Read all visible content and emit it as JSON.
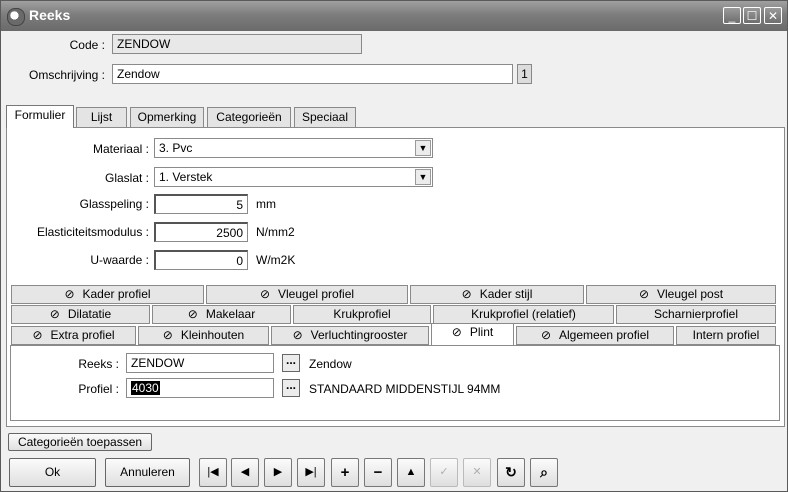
{
  "window": {
    "title": "Reeks",
    "buttons": {
      "minimize": "_",
      "maximize": "☐",
      "close": "✕"
    }
  },
  "header": {
    "code_label": "Code :",
    "code_value": "ZENDOW",
    "omschrijving_label": "Omschrijving :",
    "omschrijving_value": "Zendow",
    "counter": "1"
  },
  "tabs": [
    {
      "label": "Formulier"
    },
    {
      "label": "Lijst"
    },
    {
      "label": "Opmerking"
    },
    {
      "label": "Categorieën"
    },
    {
      "label": "Speciaal"
    }
  ],
  "form": {
    "materiaal_label": "Materiaal :",
    "materiaal_value": "3.  Pvc",
    "glaslat_label": "Glaslat :",
    "glaslat_value": "1.  Verstek",
    "glasspeling_label": "Glasspeling :",
    "glasspeling_value": "5",
    "glasspeling_unit": "mm",
    "elasticiteit_label": "Elasticiteitsmodulus :",
    "elasticiteit_value": "2500",
    "elasticiteit_unit": "N/mm2",
    "uwaarde_label": "U-waarde :",
    "uwaarde_value": "0",
    "uwaarde_unit": "W/m2K"
  },
  "inner_tabs": {
    "row1": [
      "Kader profiel",
      "Vleugel profiel",
      "Kader stijl",
      "Vleugel post"
    ],
    "row2": [
      "Dilatatie",
      "Makelaar",
      "Krukprofiel",
      "Krukprofiel (relatief)",
      "Scharnierprofiel"
    ],
    "row3": [
      "Extra profiel",
      "Kleinhouten",
      "Verluchtingrooster",
      "Plint",
      "Algemeen profiel",
      "Intern profiel"
    ]
  },
  "plint": {
    "reeks_label": "Reeks :",
    "reeks_value": "ZENDOW",
    "reeks_desc": "Zendow",
    "profiel_label": "Profiel :",
    "profiel_value": "4030",
    "profiel_desc": "STANDAARD MIDDENSTIJL 94MM",
    "browse_label": "..."
  },
  "buttons": {
    "apply_categories": "Categorieën toepassen",
    "ok": "Ok",
    "cancel": "Annuleren"
  },
  "nav": {
    "first": "|◀",
    "prev": "◀",
    "next": "▶",
    "last": "▶|",
    "add": "+",
    "delete": "−",
    "up": "▲",
    "confirm": "✓",
    "cancel_edit": "✕",
    "refresh": "↻",
    "find": "⌕"
  }
}
